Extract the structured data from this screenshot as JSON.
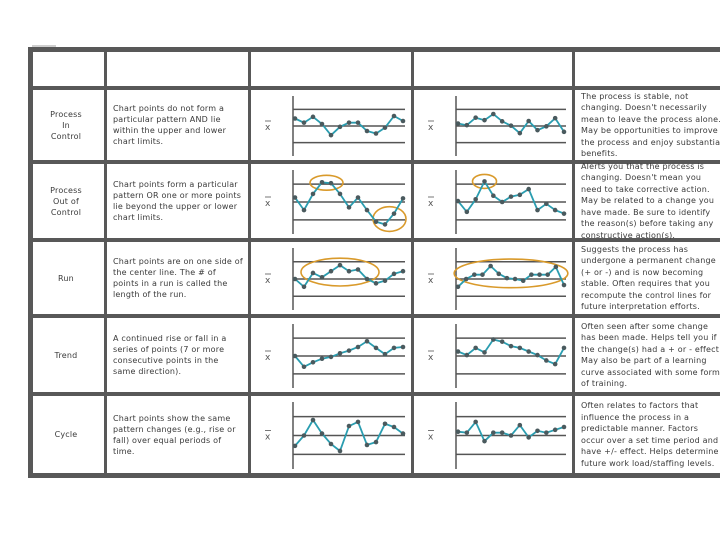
{
  "table": {
    "header": [
      "",
      "",
      "",
      "",
      ""
    ],
    "rows": [
      {
        "label": "Process\nIn\nControl",
        "definition": "Chart points do not form a particular pattern AND lie within the upper and lower chart limits.",
        "description": "The process is stable, not changing. Doesn't necessarily mean to leave the process alone. May be opportunities to improve the process and enjoy substantial benefits."
      },
      {
        "label": "Process\nOut of\nControl",
        "definition": "Chart points form a particular pattern OR one or more points lie beyond the upper or lower chart limits.",
        "description": "Alerts you that the process is changing. Doesn't mean you need to take corrective action. May be related to a change you have made. Be sure to identify the reason(s) before taking any constructive action(s)."
      },
      {
        "label": "Run",
        "definition": "Chart points are on one side of the center line. The # of points in a run is called the length of the run.",
        "description": "Suggests the process has undergone a permanent change (+ or -) and is now becoming stable. Often requires that you recompute the control lines for future interpretation efforts."
      },
      {
        "label": "Trend",
        "definition": "A continued rise or fall in a series of points (7 or more consecutive points in the same direction).",
        "description": "Often seen after some change has been made. Helps tell you if the change(s) had a + or - effect. May also be part of a learning curve associated with some form of training."
      },
      {
        "label": "Cycle",
        "definition": "Chart points show the same pattern changes (e.g., rise or fall) over equal periods of time.",
        "description": "Often relates to factors that influence the process in a predictable manner. Factors occur over a set time period and have +/- effect. Helps determine future work load/staffing levels."
      }
    ]
  },
  "colors": {
    "line": "#2a9db0",
    "point": "#4a5a5e",
    "highlight": "#d99a2b",
    "grid": "#555555"
  },
  "chart_data": [
    {
      "type": "line",
      "row": "Process In Control",
      "panel": 1,
      "axis_label": "x̄",
      "levels": [
        "UCL",
        "CL",
        "LCL"
      ],
      "ylim": [
        -1,
        1
      ],
      "highlights": [],
      "values": [
        0.45,
        0.2,
        0.55,
        0.12,
        -0.55,
        -0.05,
        0.2,
        0.2,
        -0.3,
        -0.45,
        -0.1,
        0.6,
        0.3
      ]
    },
    {
      "type": "line",
      "row": "Process In Control",
      "panel": 2,
      "axis_label": "x̄",
      "levels": [
        "UCL",
        "CL",
        "LCL"
      ],
      "ylim": [
        -1,
        1
      ],
      "highlights": [],
      "values": [
        0.15,
        0.05,
        0.5,
        0.35,
        0.72,
        0.28,
        0.02,
        -0.43,
        0.3,
        -0.25,
        -0.02,
        0.47,
        -0.35
      ]
    },
    {
      "type": "line",
      "row": "Process Out of Control",
      "panel": 1,
      "axis_label": "x̄",
      "levels": [
        "UCL",
        "CL",
        "LCL"
      ],
      "ylim": [
        -1,
        1
      ],
      "highlights": [
        [
          3,
          4
        ],
        [
          10,
          11
        ]
      ],
      "values": [
        0.25,
        -0.45,
        0.45,
        1.1,
        1.05,
        0.45,
        -0.3,
        0.25,
        -0.45,
        -1.1,
        -1.25,
        -0.65,
        0.2
      ]
    },
    {
      "type": "line",
      "row": "Process Out of Control",
      "panel": 2,
      "axis_label": "x̄",
      "levels": [
        "UCL",
        "CL",
        "LCL"
      ],
      "ylim": [
        -1,
        1
      ],
      "highlights": [
        [
          3
        ]
      ],
      "values": [
        0.05,
        -0.55,
        0.15,
        1.15,
        0.35,
        0.0,
        0.3,
        0.4,
        0.72,
        -0.45,
        -0.1,
        -0.45,
        -0.65
      ]
    },
    {
      "type": "line",
      "row": "Run",
      "panel": 1,
      "axis_label": "x̄",
      "levels": [
        "UCL",
        "CL",
        "LCL"
      ],
      "ylim": [
        -1,
        1
      ],
      "highlights": [
        [
          2,
          8
        ]
      ],
      "values": [
        0.0,
        -0.45,
        0.35,
        0.1,
        0.45,
        0.8,
        0.45,
        0.55,
        0.0,
        -0.25,
        -0.1,
        0.3,
        0.45
      ]
    },
    {
      "type": "line",
      "row": "Run",
      "panel": 2,
      "axis_label": "x̄",
      "levels": [
        "UCL",
        "CL",
        "LCL"
      ],
      "ylim": [
        -1,
        1
      ],
      "highlights": [
        [
          1,
          12
        ]
      ],
      "values": [
        -0.45,
        0.0,
        0.25,
        0.25,
        0.75,
        0.3,
        0.05,
        0.0,
        -0.1,
        0.25,
        0.25,
        0.25,
        0.7,
        -0.35
      ]
    },
    {
      "type": "line",
      "row": "Trend",
      "panel": 1,
      "axis_label": "x̄",
      "levels": [
        "UCL",
        "CL",
        "LCL"
      ],
      "ylim": [
        -1,
        1
      ],
      "highlights": [],
      "values": [
        0.0,
        -0.6,
        -0.35,
        -0.15,
        -0.05,
        0.15,
        0.3,
        0.5,
        0.82,
        0.45,
        0.1,
        0.45,
        0.5
      ]
    },
    {
      "type": "line",
      "row": "Trend",
      "panel": 2,
      "axis_label": "x̄",
      "levels": [
        "UCL",
        "CL",
        "LCL"
      ],
      "ylim": [
        -1,
        1
      ],
      "highlights": [],
      "values": [
        0.25,
        0.05,
        0.45,
        0.2,
        0.92,
        0.8,
        0.55,
        0.45,
        0.25,
        0.05,
        -0.25,
        -0.45,
        0.45
      ]
    },
    {
      "type": "line",
      "row": "Cycle",
      "panel": 1,
      "axis_label": "x̄",
      "levels": [
        "UCL",
        "CL",
        "LCL"
      ],
      "ylim": [
        -1,
        1
      ],
      "highlights": [],
      "values": [
        -0.55,
        0.0,
        0.82,
        0.1,
        -0.45,
        -0.82,
        0.5,
        0.72,
        -0.5,
        -0.35,
        0.62,
        0.45,
        0.1
      ]
    },
    {
      "type": "line",
      "row": "Cycle",
      "panel": 2,
      "axis_label": "x̄",
      "levels": [
        "UCL",
        "CL",
        "LCL"
      ],
      "ylim": [
        -1,
        1
      ],
      "highlights": [],
      "values": [
        0.2,
        0.15,
        0.72,
        -0.3,
        0.15,
        0.15,
        0.0,
        0.55,
        -0.1,
        0.25,
        0.15,
        0.3,
        0.45
      ]
    }
  ]
}
